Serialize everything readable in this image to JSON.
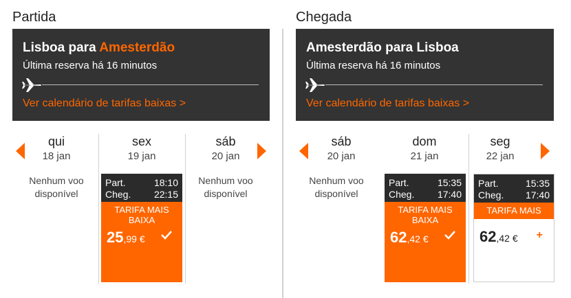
{
  "outbound": {
    "heading": "Partida",
    "route_from": "Lisboa para",
    "route_to": "Amesterdão",
    "last_booking": "Última reserva há 16 minutos",
    "calendar_link": "Ver calendário de tarifas baixas >",
    "days": [
      {
        "dow": "qui",
        "date": "18 jan",
        "no_flight": "Nenhum voo disponível"
      },
      {
        "dow": "sex",
        "date": "19 jan",
        "dep_label": "Part.",
        "dep_time": "18:10",
        "arr_label": "Cheg.",
        "arr_time": "22:15",
        "fare_label": "TARIFA MAIS BAIXA",
        "price_int": "25",
        "price_dec": ",99 €",
        "selected": true
      },
      {
        "dow": "sáb",
        "date": "20 jan",
        "no_flight": "Nenhum voo disponível"
      }
    ]
  },
  "inbound": {
    "heading": "Chegada",
    "route_full": "Amesterdão para Lisboa",
    "last_booking": "Última reserva há 16 minutos",
    "calendar_link": "Ver calendário de tarifas baixas >",
    "days": [
      {
        "dow": "sáb",
        "date": "20 jan",
        "no_flight": "Nenhum voo disponível"
      },
      {
        "dow": "dom",
        "date": "21 jan",
        "dep_label": "Part.",
        "dep_time": "15:35",
        "arr_label": "Cheg.",
        "arr_time": "17:40",
        "fare_label": "TARIFA MAIS BAIXA",
        "price_int": "62",
        "price_dec": ",42 €",
        "selected": true
      },
      {
        "dow": "seg",
        "date": "22 jan",
        "dep_label": "Part.",
        "dep_time": "15:35",
        "arr_label": "Cheg.",
        "arr_time": "17:40",
        "fare_label": "TARIFA MAIS",
        "price_int": "62",
        "price_dec": ",42 €",
        "selected": false
      }
    ]
  },
  "colors": {
    "accent": "#ff6600",
    "banner": "#333333",
    "times_bg": "#2b2b2b"
  }
}
